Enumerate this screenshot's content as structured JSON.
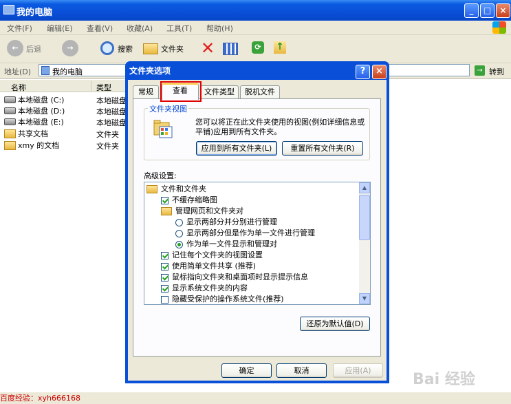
{
  "window": {
    "title": "我的电脑"
  },
  "menu": [
    "文件(F)",
    "编辑(E)",
    "查看(V)",
    "收藏(A)",
    "工具(T)",
    "帮助(H)"
  ],
  "toolbar": {
    "back": "后退",
    "search": "搜索",
    "folders": "文件夹"
  },
  "address": {
    "label": "地址(D)",
    "value": "我的电脑",
    "go": "转到"
  },
  "columns": {
    "name": "名称",
    "type": "类型"
  },
  "files": [
    {
      "name": "本地磁盘 (C:)",
      "type": "本地磁盘",
      "kind": "drive"
    },
    {
      "name": "本地磁盘 (D:)",
      "type": "本地磁盘",
      "kind": "drive"
    },
    {
      "name": "本地磁盘 (E:)",
      "type": "本地磁盘",
      "kind": "drive"
    },
    {
      "name": "共享文档",
      "type": "文件夹",
      "kind": "folder"
    },
    {
      "name": "xmy 的文档",
      "type": "文件夹",
      "kind": "folder"
    }
  ],
  "dialog": {
    "title": "文件夹选项",
    "tabs": [
      "常规",
      "查看",
      "文件类型",
      "脱机文件"
    ],
    "active_tab": "查看",
    "group_label": "文件夹视图",
    "description": "您可以将正在此文件夹使用的视图(例如详细信息或平铺)应用到所有文件夹。",
    "apply_all_button": "应用到所有文件夹(L)",
    "reset_all_button": "重置所有文件夹(R)",
    "advanced_label": "高级设置:",
    "tree": [
      {
        "type": "folder",
        "label": "文件和文件夹",
        "indent": 0
      },
      {
        "type": "checkbox",
        "label": "不缓存缩略图",
        "checked": true,
        "indent": 1
      },
      {
        "type": "folder",
        "label": "管理网页和文件夹对",
        "indent": 1
      },
      {
        "type": "radio",
        "label": "显示两部分并分别进行管理",
        "checked": false,
        "indent": 2
      },
      {
        "type": "radio",
        "label": "显示两部分但是作为单一文件进行管理",
        "checked": false,
        "indent": 2
      },
      {
        "type": "radio",
        "label": "作为单一文件显示和管理对",
        "checked": true,
        "indent": 2
      },
      {
        "type": "checkbox",
        "label": "记住每个文件夹的视图设置",
        "checked": true,
        "indent": 1
      },
      {
        "type": "checkbox",
        "label": "使用简单文件共享 (推荐)",
        "checked": true,
        "indent": 1
      },
      {
        "type": "checkbox",
        "label": "鼠标指向文件夹和桌面项时显示提示信息",
        "checked": true,
        "indent": 1
      },
      {
        "type": "checkbox",
        "label": "显示系统文件夹的内容",
        "checked": true,
        "indent": 1
      },
      {
        "type": "checkbox",
        "label": "隐藏受保护的操作系统文件(推荐)",
        "checked": false,
        "indent": 1
      }
    ],
    "restore_button": "还原为默认值(D)",
    "ok_button": "确定",
    "cancel_button": "取消",
    "apply_button": "应用(A)"
  },
  "watermark": "百度经验：xyh666168",
  "baidu_mark": "Bai 经验",
  "colors": {
    "title_blue": "#0a4fd8",
    "highlight_red": "#e00000",
    "check_green": "#21a121"
  }
}
